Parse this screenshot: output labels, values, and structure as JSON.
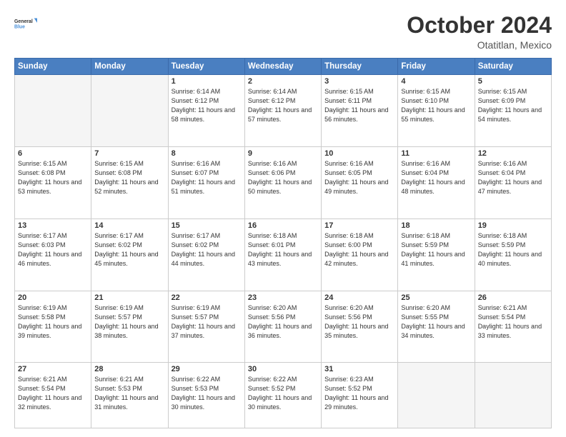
{
  "logo": {
    "general": "General",
    "blue": "Blue"
  },
  "header": {
    "month": "October 2024",
    "location": "Otatitlan, Mexico"
  },
  "weekdays": [
    "Sunday",
    "Monday",
    "Tuesday",
    "Wednesday",
    "Thursday",
    "Friday",
    "Saturday"
  ],
  "weeks": [
    [
      {
        "day": "",
        "info": ""
      },
      {
        "day": "",
        "info": ""
      },
      {
        "day": "1",
        "info": "Sunrise: 6:14 AM\nSunset: 6:12 PM\nDaylight: 11 hours and 58 minutes."
      },
      {
        "day": "2",
        "info": "Sunrise: 6:14 AM\nSunset: 6:12 PM\nDaylight: 11 hours and 57 minutes."
      },
      {
        "day": "3",
        "info": "Sunrise: 6:15 AM\nSunset: 6:11 PM\nDaylight: 11 hours and 56 minutes."
      },
      {
        "day": "4",
        "info": "Sunrise: 6:15 AM\nSunset: 6:10 PM\nDaylight: 11 hours and 55 minutes."
      },
      {
        "day": "5",
        "info": "Sunrise: 6:15 AM\nSunset: 6:09 PM\nDaylight: 11 hours and 54 minutes."
      }
    ],
    [
      {
        "day": "6",
        "info": "Sunrise: 6:15 AM\nSunset: 6:08 PM\nDaylight: 11 hours and 53 minutes."
      },
      {
        "day": "7",
        "info": "Sunrise: 6:15 AM\nSunset: 6:08 PM\nDaylight: 11 hours and 52 minutes."
      },
      {
        "day": "8",
        "info": "Sunrise: 6:16 AM\nSunset: 6:07 PM\nDaylight: 11 hours and 51 minutes."
      },
      {
        "day": "9",
        "info": "Sunrise: 6:16 AM\nSunset: 6:06 PM\nDaylight: 11 hours and 50 minutes."
      },
      {
        "day": "10",
        "info": "Sunrise: 6:16 AM\nSunset: 6:05 PM\nDaylight: 11 hours and 49 minutes."
      },
      {
        "day": "11",
        "info": "Sunrise: 6:16 AM\nSunset: 6:04 PM\nDaylight: 11 hours and 48 minutes."
      },
      {
        "day": "12",
        "info": "Sunrise: 6:16 AM\nSunset: 6:04 PM\nDaylight: 11 hours and 47 minutes."
      }
    ],
    [
      {
        "day": "13",
        "info": "Sunrise: 6:17 AM\nSunset: 6:03 PM\nDaylight: 11 hours and 46 minutes."
      },
      {
        "day": "14",
        "info": "Sunrise: 6:17 AM\nSunset: 6:02 PM\nDaylight: 11 hours and 45 minutes."
      },
      {
        "day": "15",
        "info": "Sunrise: 6:17 AM\nSunset: 6:02 PM\nDaylight: 11 hours and 44 minutes."
      },
      {
        "day": "16",
        "info": "Sunrise: 6:18 AM\nSunset: 6:01 PM\nDaylight: 11 hours and 43 minutes."
      },
      {
        "day": "17",
        "info": "Sunrise: 6:18 AM\nSunset: 6:00 PM\nDaylight: 11 hours and 42 minutes."
      },
      {
        "day": "18",
        "info": "Sunrise: 6:18 AM\nSunset: 5:59 PM\nDaylight: 11 hours and 41 minutes."
      },
      {
        "day": "19",
        "info": "Sunrise: 6:18 AM\nSunset: 5:59 PM\nDaylight: 11 hours and 40 minutes."
      }
    ],
    [
      {
        "day": "20",
        "info": "Sunrise: 6:19 AM\nSunset: 5:58 PM\nDaylight: 11 hours and 39 minutes."
      },
      {
        "day": "21",
        "info": "Sunrise: 6:19 AM\nSunset: 5:57 PM\nDaylight: 11 hours and 38 minutes."
      },
      {
        "day": "22",
        "info": "Sunrise: 6:19 AM\nSunset: 5:57 PM\nDaylight: 11 hours and 37 minutes."
      },
      {
        "day": "23",
        "info": "Sunrise: 6:20 AM\nSunset: 5:56 PM\nDaylight: 11 hours and 36 minutes."
      },
      {
        "day": "24",
        "info": "Sunrise: 6:20 AM\nSunset: 5:56 PM\nDaylight: 11 hours and 35 minutes."
      },
      {
        "day": "25",
        "info": "Sunrise: 6:20 AM\nSunset: 5:55 PM\nDaylight: 11 hours and 34 minutes."
      },
      {
        "day": "26",
        "info": "Sunrise: 6:21 AM\nSunset: 5:54 PM\nDaylight: 11 hours and 33 minutes."
      }
    ],
    [
      {
        "day": "27",
        "info": "Sunrise: 6:21 AM\nSunset: 5:54 PM\nDaylight: 11 hours and 32 minutes."
      },
      {
        "day": "28",
        "info": "Sunrise: 6:21 AM\nSunset: 5:53 PM\nDaylight: 11 hours and 31 minutes."
      },
      {
        "day": "29",
        "info": "Sunrise: 6:22 AM\nSunset: 5:53 PM\nDaylight: 11 hours and 30 minutes."
      },
      {
        "day": "30",
        "info": "Sunrise: 6:22 AM\nSunset: 5:52 PM\nDaylight: 11 hours and 30 minutes."
      },
      {
        "day": "31",
        "info": "Sunrise: 6:23 AM\nSunset: 5:52 PM\nDaylight: 11 hours and 29 minutes."
      },
      {
        "day": "",
        "info": ""
      },
      {
        "day": "",
        "info": ""
      }
    ]
  ]
}
